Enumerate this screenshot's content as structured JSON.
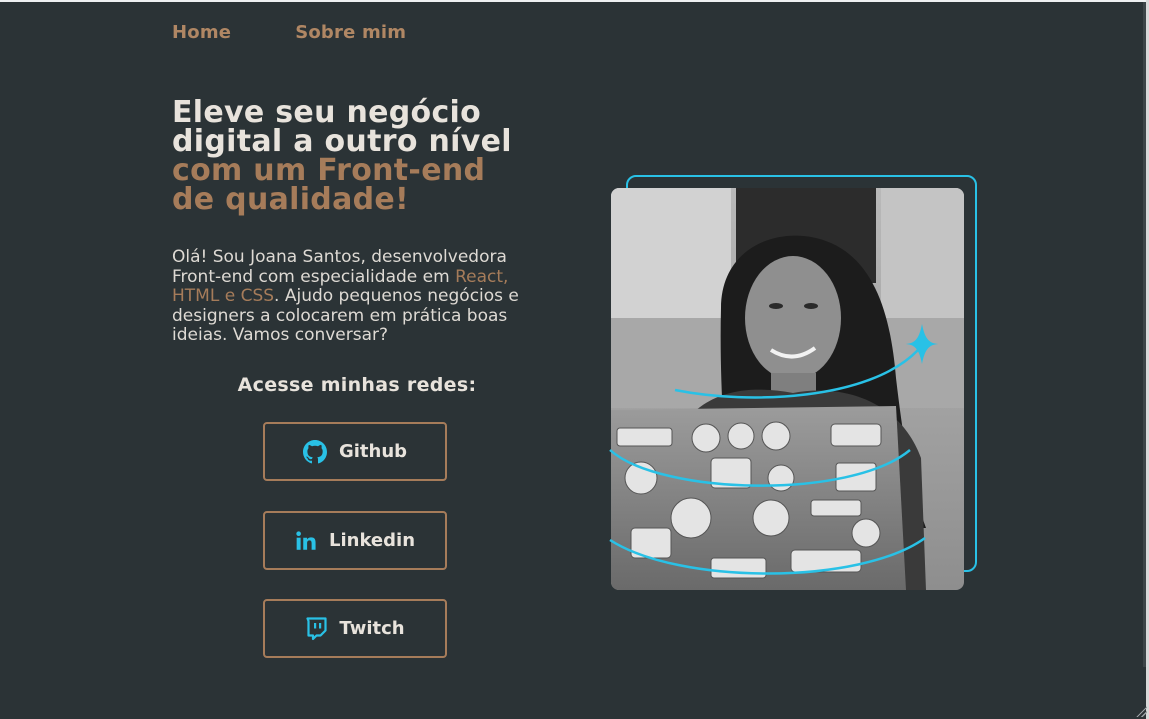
{
  "nav": {
    "items": [
      {
        "label": "Home"
      },
      {
        "label": "Sobre mim"
      }
    ]
  },
  "hero": {
    "headline_line1": "Eleve seu negócio",
    "headline_line2": "digital a outro nível",
    "headline_line3": "com um Front-end",
    "headline_line4": "de qualidade!",
    "intro_part1": "Olá! Sou Joana Santos, desenvolvedora Front-end com especialidade em ",
    "intro_highlight": "React, HTML e CSS",
    "intro_part2": ". Ajudo pequenos negócios e designers a colocarem em prática boas ideias. Vamos conversar?"
  },
  "socials": {
    "title": "Acesse minhas redes:",
    "buttons": [
      {
        "label": "Github",
        "icon": "github-icon"
      },
      {
        "label": "Linkedin",
        "icon": "linkedin-icon"
      },
      {
        "label": "Twitch",
        "icon": "twitch-icon"
      }
    ]
  },
  "image": {
    "alt": "Joana Santos"
  },
  "colors": {
    "background": "#2b3336",
    "accent": "#a67c5a",
    "text": "#e8e3dc",
    "cyan": "#29c1e6"
  }
}
